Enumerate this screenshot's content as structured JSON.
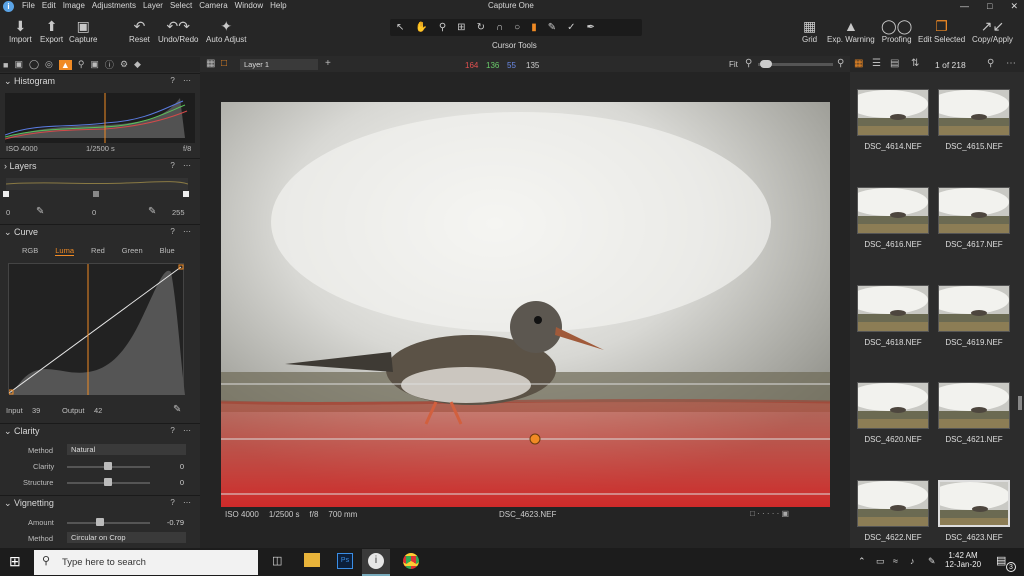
{
  "menu": {
    "items": [
      "File",
      "Edit",
      "Image",
      "Adjustments",
      "Layer",
      "Select",
      "Camera",
      "Window",
      "Help"
    ]
  },
  "app": {
    "title": "Capture One"
  },
  "toolbar": {
    "import": "Import",
    "export": "Export",
    "capture": "Capture",
    "reset": "Reset",
    "undo_redo": "Undo/Redo",
    "auto_adjust": "Auto Adjust",
    "cursor_tools": "Cursor Tools",
    "grid": "Grid",
    "exp_warning": "Exp. Warning",
    "proofing": "Proofing",
    "edit_selected": "Edit Selected",
    "copy_apply": "Copy/Apply"
  },
  "viewerbar": {
    "layer": "Layer 1",
    "r": "164",
    "g": "136",
    "b": "55",
    "l": "135",
    "zoom": "Fit"
  },
  "histogram": {
    "title": "Histogram",
    "iso": "ISO 4000",
    "shutter": "1/2500 s",
    "aperture": "f/8"
  },
  "layers": {
    "title": "Layers",
    "left": "0",
    "mid": "0",
    "right": "255"
  },
  "curve": {
    "title": "Curve",
    "tabs": [
      "RGB",
      "Luma",
      "Red",
      "Green",
      "Blue"
    ],
    "active_tab": "Luma",
    "input_label": "Input",
    "input": "39",
    "output_label": "Output",
    "output": "42"
  },
  "clarity": {
    "title": "Clarity",
    "method_label": "Method",
    "method": "Natural",
    "clarity_label": "Clarity",
    "clarity": "0",
    "structure_label": "Structure",
    "structure": "0"
  },
  "vignetting": {
    "title": "Vignetting",
    "amount_label": "Amount",
    "amount": "-0.79",
    "amount_level": 0.45,
    "method_label": "Method",
    "method": "Circular on Crop"
  },
  "viewer": {
    "iso": "ISO 4000",
    "shutter": "1/2500 s",
    "aperture": "f/8",
    "focal": "700 mm",
    "filename": "DSC_4623.NEF"
  },
  "browser": {
    "count": "1 of 218",
    "thumbs": [
      "DSC_4614.NEF",
      "DSC_4615.NEF",
      "DSC_4616.NEF",
      "DSC_4617.NEF",
      "DSC_4618.NEF",
      "DSC_4619.NEF",
      "DSC_4620.NEF",
      "DSC_4621.NEF",
      "DSC_4622.NEF",
      "DSC_4623.NEF"
    ]
  },
  "taskbar": {
    "search_placeholder": "Type here to search",
    "time": "1:42 AM",
    "date": "12-Jan-20",
    "notifications": "3"
  },
  "colors": {
    "accent": "#f08a24",
    "mask": "#d42a2a"
  }
}
